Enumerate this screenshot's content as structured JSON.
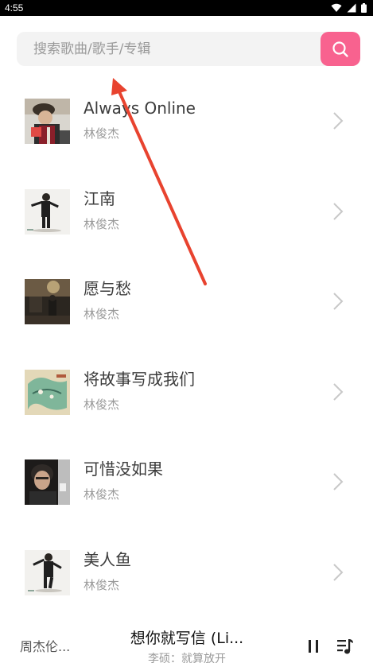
{
  "status_bar": {
    "time": "4:55"
  },
  "search": {
    "placeholder": "搜索歌曲/歌手/专辑",
    "button_icon": "search-icon",
    "accent_color": "#f8628f"
  },
  "songs": [
    {
      "title": "Always Online",
      "artist": "林俊杰"
    },
    {
      "title": "江南",
      "artist": "林俊杰"
    },
    {
      "title": "愿与愁",
      "artist": "林俊杰"
    },
    {
      "title": "将故事写成我们",
      "artist": "林俊杰"
    },
    {
      "title": "可惜没如果",
      "artist": "林俊杰"
    },
    {
      "title": "美人鱼",
      "artist": "林俊杰"
    }
  ],
  "player": {
    "prev_label": "周杰伦...",
    "now_title": "想你就写信 (Li...",
    "now_sub": "李硕：就算放开",
    "pause_icon": "pause-icon",
    "playlist_icon": "playlist-icon"
  },
  "annotation": {
    "arrow_color": "#e8432f"
  }
}
